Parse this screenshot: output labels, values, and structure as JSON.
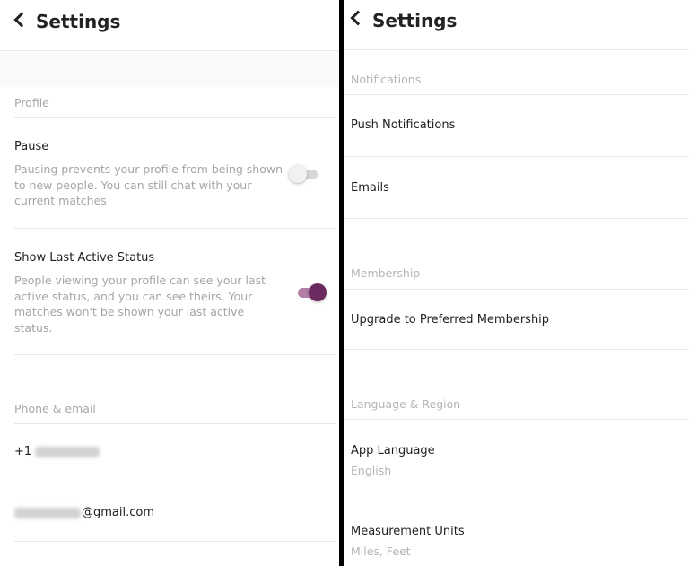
{
  "left": {
    "title": "Settings",
    "profile": {
      "section_label": "Profile",
      "pause": {
        "label": "Pause",
        "description": "Pausing prevents your profile from being shown to new people. You can still chat with your current matches",
        "enabled": false
      },
      "last_active": {
        "label": "Show Last Active Status",
        "description": "People viewing your profile can see your last active status, and you can see theirs. Your matches won't be shown your last active status.",
        "enabled": true
      }
    },
    "contact": {
      "section_label": "Phone & email",
      "phone_prefix": "+1",
      "email_suffix": "@gmail.com"
    }
  },
  "right": {
    "title": "Settings",
    "notifications": {
      "section_label": "Notifications",
      "push": "Push Notifications",
      "emails": "Emails"
    },
    "membership": {
      "section_label": "Membership",
      "upgrade": "Upgrade to Preferred Membership"
    },
    "language_region": {
      "section_label": "Language & Region",
      "app_language": {
        "label": "App Language",
        "value": "English"
      },
      "measurement_units": {
        "label": "Measurement Units",
        "value": "Miles, Feet"
      }
    }
  },
  "colors": {
    "accent": "#6b2a60",
    "accent_track": "#b27fa6",
    "section_text": "#a9a9a9",
    "divider": "#000000"
  },
  "icons": [
    "back-chevron-icon",
    "toggle-switch"
  ]
}
